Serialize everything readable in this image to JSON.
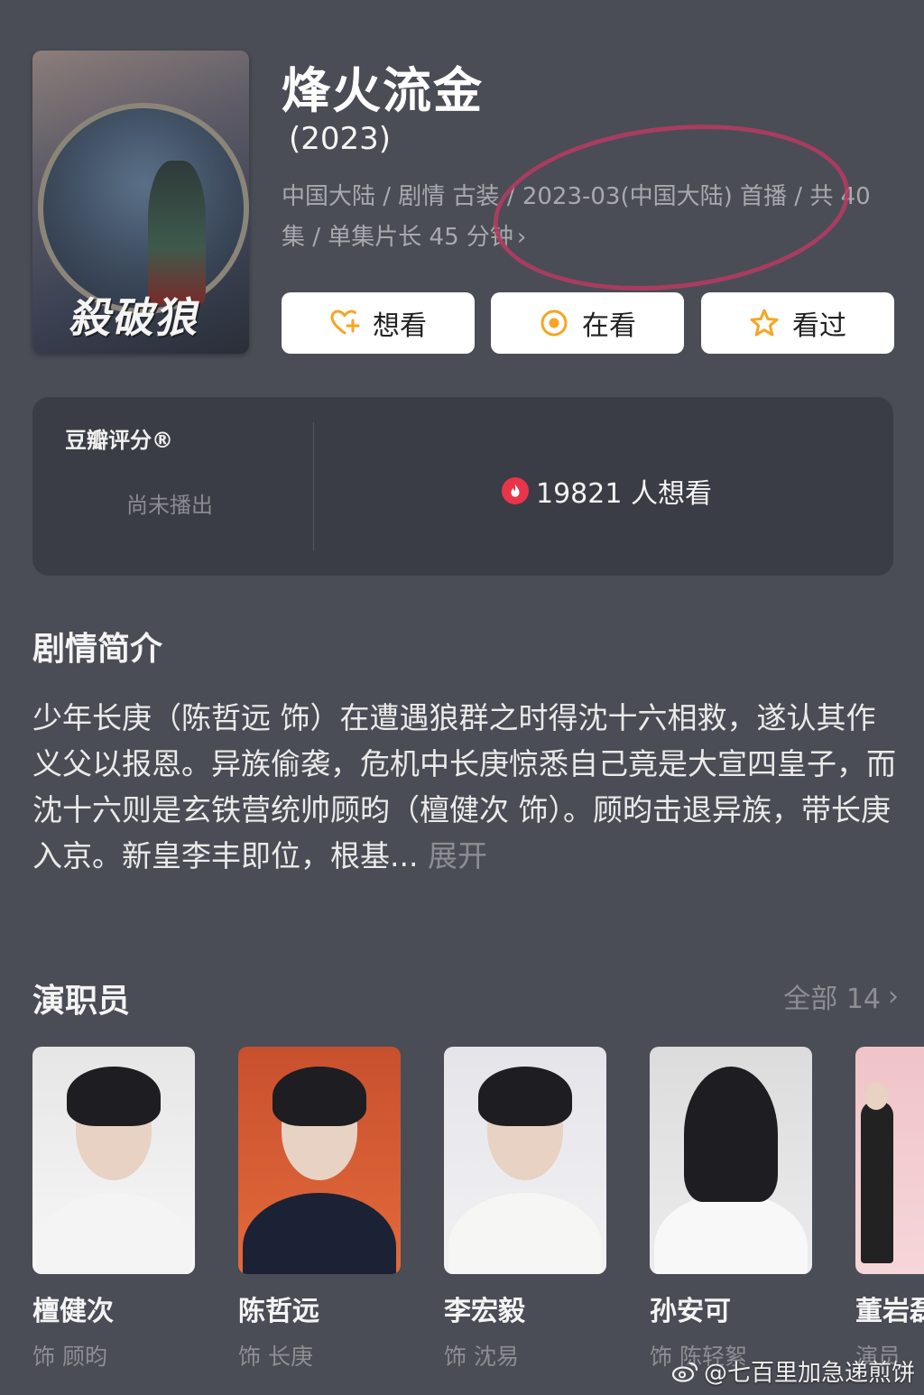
{
  "show": {
    "title": "烽火流金",
    "year": "(2023)",
    "meta_line1": "中国大陆 / 剧情 古装 / 2023-03(中国大陆) 首播 / 共 40",
    "meta_line2": "集 / 单集片长 45 分钟",
    "poster_title": "殺破狼"
  },
  "actions": {
    "want": "想看",
    "watching": "在看",
    "watched": "看过"
  },
  "rating": {
    "label": "豆瓣评分®",
    "status": "尚未播出",
    "want_count": "19821 人想看"
  },
  "synopsis": {
    "heading": "剧情简介",
    "text": "少年长庚（陈哲远 饰）在遭遇狼群之时得沈十六相救，遂认其作义父以报恩。异族偷袭，危机中长庚惊悉自己竟是大宣四皇子，而沈十六则是玄铁营统帅顾昀（檀健次 饰）。顾昀击退异族，带长庚入京。新皇李丰即位，根基...",
    "expand": "展开"
  },
  "cast": {
    "heading": "演职员",
    "all_label": "全部 14",
    "members": [
      {
        "name": "檀健次",
        "role": "饰 顾昀"
      },
      {
        "name": "陈哲远",
        "role": "饰 长庚"
      },
      {
        "name": "李宏毅",
        "role": "饰 沈易"
      },
      {
        "name": "孙安可",
        "role": "饰 陈轻絮"
      },
      {
        "name": "董岩磊",
        "role": "演员"
      }
    ]
  },
  "watermark": "@七百里加急递煎饼",
  "colors": {
    "background": "#4a4d55",
    "card": "#3a3d45",
    "accent": "#f5a623",
    "flame": "#e9344a",
    "annotation_circle": "#b83a64"
  },
  "icons": {
    "want": "heart-plus-icon",
    "watching": "target-circle-icon",
    "watched": "star-outline-icon",
    "want_count": "flame-icon"
  }
}
